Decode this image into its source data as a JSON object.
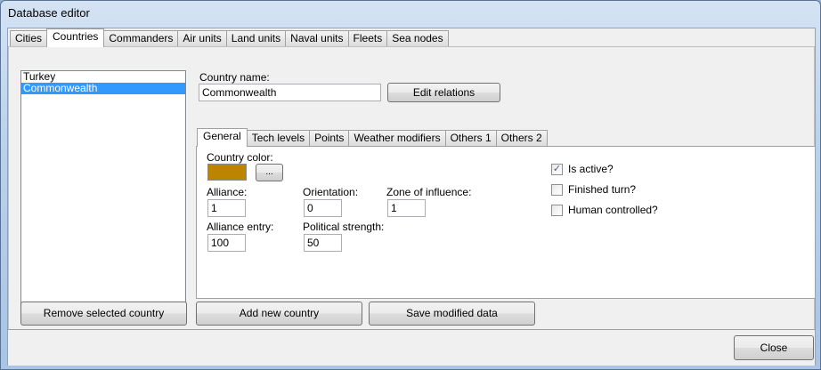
{
  "window": {
    "title": "Database editor"
  },
  "tabs": [
    "Cities",
    "Countries",
    "Commanders",
    "Air units",
    "Land units",
    "Naval units",
    "Fleets",
    "Sea nodes"
  ],
  "active_tab": "Countries",
  "countries": [
    "Turkey",
    "Commonwealth"
  ],
  "selected_country": "Commonwealth",
  "country_name_label": "Country name:",
  "country_name_value": "Commonwealth",
  "edit_relations": "Edit relations",
  "subtabs": [
    "General",
    "Tech levels",
    "Points",
    "Weather modifiers",
    "Others 1",
    "Others 2"
  ],
  "general": {
    "country_color_label": "Country color:",
    "country_color": "#bb8500",
    "color_button": "...",
    "alliance_label": "Alliance:",
    "alliance": "1",
    "orientation_label": "Orientation:",
    "orientation": "0",
    "zone_label": "Zone of influence:",
    "zone": "1",
    "alliance_entry_label": "Alliance entry:",
    "alliance_entry": "100",
    "political_strength_label": "Political strength:",
    "political_strength": "50",
    "is_active": "Is active?",
    "finished_turn": "Finished turn?",
    "human_controlled": "Human controlled?"
  },
  "buttons": {
    "remove": "Remove selected country",
    "add": "Add new country",
    "save": "Save modified data",
    "close": "Close"
  }
}
